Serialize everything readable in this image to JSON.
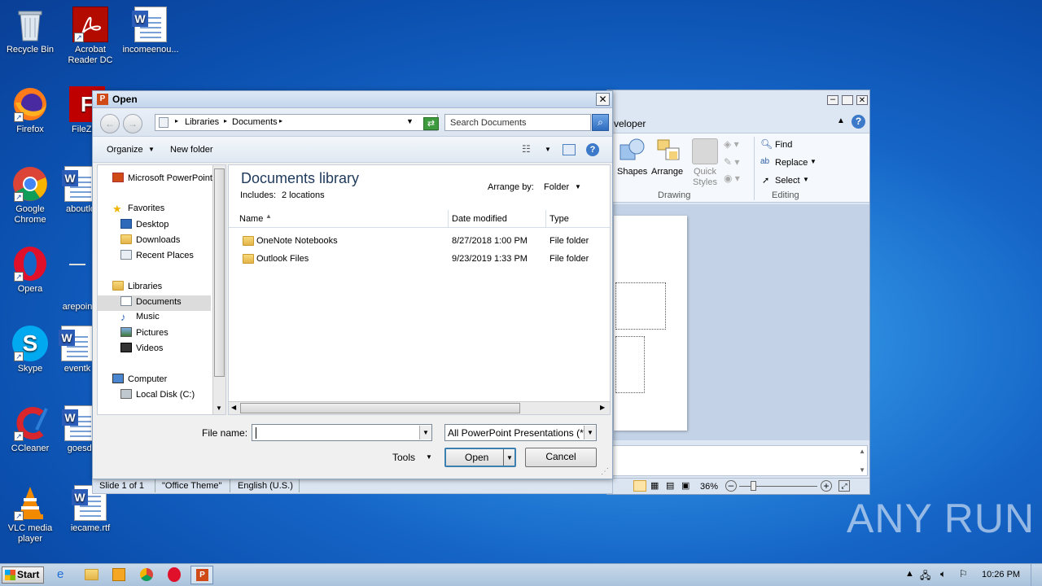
{
  "desktop_icons": [
    {
      "label": "Recycle Bin",
      "icon": "recycle-bin-icon"
    },
    {
      "label": "Acrobat Reader DC",
      "icon": "acrobat-icon"
    },
    {
      "label": "incomeenou...",
      "icon": "word-doc-icon"
    },
    {
      "label": "Firefox",
      "icon": "firefox-icon"
    },
    {
      "label": "FileZilla",
      "icon": "filezilla-icon"
    },
    {
      "label": "Google Chrome",
      "icon": "chrome-icon"
    },
    {
      "label": "aboutlo",
      "icon": "word-doc-icon"
    },
    {
      "label": "Opera",
      "icon": "opera-icon"
    },
    {
      "label": "arepoin",
      "icon": "doc-icon"
    },
    {
      "label": "Skype",
      "icon": "skype-icon"
    },
    {
      "label": "eventk",
      "icon": "word-doc-icon"
    },
    {
      "label": "CCleaner",
      "icon": "ccleaner-icon"
    },
    {
      "label": "goesdi",
      "icon": "word-doc-icon"
    },
    {
      "label": "VLC media player",
      "icon": "vlc-icon"
    },
    {
      "label": "iecame.rtf",
      "icon": "word-doc-icon"
    }
  ],
  "ppt_window": {
    "ribbon_tab": "veloper",
    "groups": {
      "drawing": {
        "label": "Drawing",
        "shapes": "Shapes",
        "arrange": "Arrange",
        "quick_styles": "Quick Styles"
      },
      "editing": {
        "label": "Editing",
        "find": "Find",
        "replace": "Replace",
        "select": "Select"
      }
    },
    "status": {
      "slide": "Slide 1 of 1",
      "theme": "\"Office Theme\"",
      "language": "English (U.S.)",
      "zoom": "36%"
    }
  },
  "dialog": {
    "title": "Open",
    "breadcrumb": [
      "Libraries",
      "Documents"
    ],
    "search_placeholder": "Search Documents",
    "toolbar": {
      "organize": "Organize",
      "new_folder": "New folder"
    },
    "nav": {
      "pinned": "Microsoft PowerPoint",
      "favorites": "Favorites",
      "favorites_items": [
        "Desktop",
        "Downloads",
        "Recent Places"
      ],
      "libraries": "Libraries",
      "libraries_items": [
        "Documents",
        "Music",
        "Pictures",
        "Videos"
      ],
      "computer": "Computer",
      "computer_items": [
        "Local Disk (C:)"
      ]
    },
    "library": {
      "heading": "Documents library",
      "includes": "Includes:",
      "locations": "2 locations",
      "arrange_label": "Arrange by:",
      "arrange_value": "Folder"
    },
    "columns": [
      "Name",
      "Date modified",
      "Type"
    ],
    "files": [
      {
        "name": "OneNote Notebooks",
        "date": "8/27/2018 1:00 PM",
        "type": "File folder"
      },
      {
        "name": "Outlook Files",
        "date": "9/23/2019 1:33 PM",
        "type": "File folder"
      }
    ],
    "file_name_label": "File name:",
    "file_name_value": "",
    "file_type": "All PowerPoint Presentations (*",
    "tools": "Tools",
    "open": "Open",
    "cancel": "Cancel"
  },
  "taskbar": {
    "start": "Start",
    "time": "10:26 PM"
  },
  "watermark": "ANY RUN"
}
